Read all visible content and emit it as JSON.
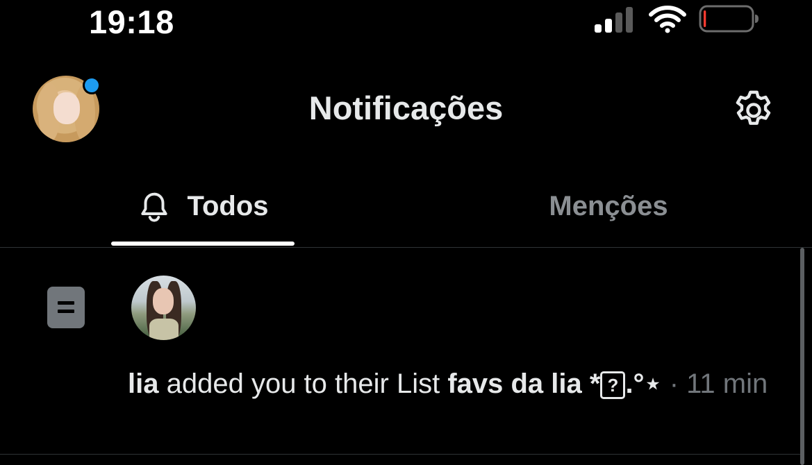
{
  "status_bar": {
    "time": "19:18",
    "signal_icon": "cellular-signal-icon",
    "wifi_icon": "wifi-icon",
    "battery_icon": "battery-low-icon",
    "battery_level": 0.05,
    "battery_color": "#ff3b30"
  },
  "header": {
    "title": "Notificações",
    "avatar_icon": "profile-avatar",
    "online_dot_color": "#1d9bf0",
    "settings_icon": "gear-icon"
  },
  "tabs": [
    {
      "label": "Todos",
      "icon": "bell-icon",
      "active": true
    },
    {
      "label": "Menções",
      "active": false
    }
  ],
  "notifications": [
    {
      "type_icon": "list-icon",
      "avatar": "lia-avatar",
      "user": "lia",
      "action": " added you to their List ",
      "list_name": "favs da lia *",
      "list_name_glyph": "?",
      "list_name_suffix": ".°⋆",
      "separator": " · ",
      "time": "11 min"
    }
  ],
  "colors": {
    "background": "#000000",
    "text": "#e7e9ea",
    "muted": "#71767b",
    "accent": "#1d9bf0"
  }
}
